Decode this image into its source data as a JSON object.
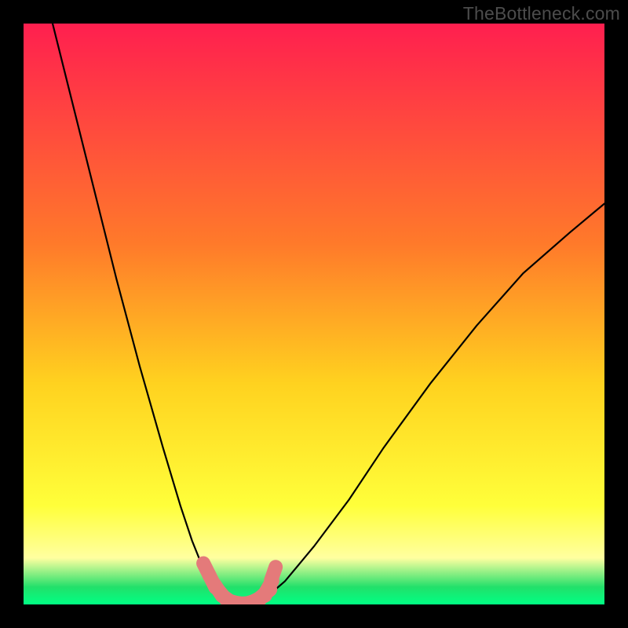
{
  "watermark": "TheBottleneck.com",
  "colors": {
    "frame": "#000000",
    "grad_top": "#ff1f4f",
    "grad_mid1": "#ff7a2a",
    "grad_mid2": "#ffd21f",
    "grad_mid3": "#ffff3a",
    "grad_lightband": "#ffffa0",
    "grad_green": "#22e06a",
    "grad_bottom": "#00ff84",
    "curve": "#000000",
    "marker": "#e47a7a"
  },
  "chart_data": {
    "type": "line",
    "title": "",
    "xlabel": "",
    "ylabel": "",
    "xlim": [
      0,
      100
    ],
    "ylim": [
      0,
      100
    ],
    "series": [
      {
        "name": "left_branch",
        "x": [
          5,
          8,
          12,
          16,
          20,
          24,
          27,
          29,
          31,
          33,
          34,
          35
        ],
        "y": [
          100,
          88,
          72,
          56,
          41,
          27,
          17,
          11,
          6,
          3,
          1.5,
          0.5
        ]
      },
      {
        "name": "valley",
        "x": [
          35,
          36,
          37,
          38,
          39,
          40,
          41,
          42
        ],
        "y": [
          0.5,
          0.2,
          0.1,
          0.05,
          0.1,
          0.3,
          0.7,
          1.4
        ]
      },
      {
        "name": "right_branch",
        "x": [
          42,
          45,
          50,
          56,
          62,
          70,
          78,
          86,
          94,
          100
        ],
        "y": [
          1.4,
          4,
          10,
          18,
          27,
          38,
          48,
          57,
          64,
          69
        ]
      }
    ],
    "markers": {
      "name": "highlight_points",
      "x": [
        31.5,
        32.5,
        33.5,
        34.5,
        35.5,
        36.5,
        37.5,
        38.5,
        39.5,
        40.5,
        41.5,
        42.2,
        43.0
      ],
      "y": [
        6.0,
        4.0,
        2.5,
        1.3,
        0.6,
        0.3,
        0.15,
        0.2,
        0.5,
        1.0,
        1.8,
        3.0,
        5.3
      ]
    },
    "gradient_bands": [
      {
        "y": 100,
        "color": "#ff1f4f"
      },
      {
        "y": 60,
        "color": "#ff7a2a"
      },
      {
        "y": 35,
        "color": "#ffd21f"
      },
      {
        "y": 15,
        "color": "#ffff3a"
      },
      {
        "y": 6,
        "color": "#ffffa0"
      },
      {
        "y": 2,
        "color": "#22e06a"
      },
      {
        "y": 0,
        "color": "#00ff84"
      }
    ]
  }
}
